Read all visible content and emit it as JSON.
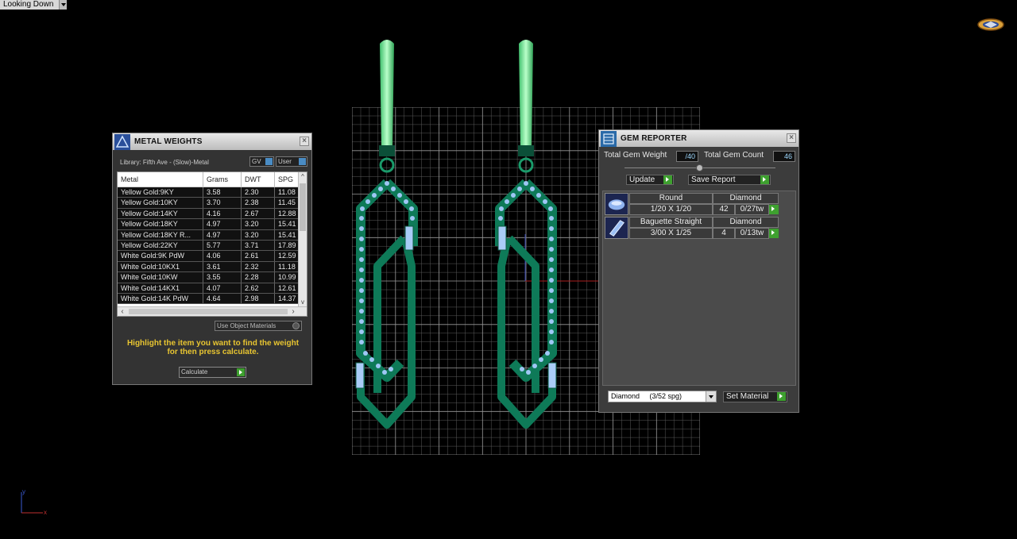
{
  "view": {
    "label": "Looking Down"
  },
  "metal_weights": {
    "title": "METAL WEIGHTS",
    "library": "Library: Fifth Ave - (Slow)-Metal",
    "gv": "GV",
    "user": "User",
    "columns": [
      "Metal",
      "Grams",
      "DWT",
      "SPG"
    ],
    "rows": [
      [
        "Yellow Gold:9KY",
        "3.58",
        "2.30",
        "11.08"
      ],
      [
        "Yellow Gold:10KY",
        "3.70",
        "2.38",
        "11.45"
      ],
      [
        "Yellow Gold:14KY",
        "4.16",
        "2.67",
        "12.88"
      ],
      [
        "Yellow Gold:18KY",
        "4.97",
        "3.20",
        "15.41"
      ],
      [
        "Yellow Gold:18KY R...",
        "4.97",
        "3.20",
        "15.41"
      ],
      [
        "Yellow Gold:22KY",
        "5.77",
        "3.71",
        "17.89"
      ],
      [
        "White Gold:9K PdW",
        "4.06",
        "2.61",
        "12.59"
      ],
      [
        "White Gold:10KX1",
        "3.61",
        "2.32",
        "11.18"
      ],
      [
        "White Gold:10KW",
        "3.55",
        "2.28",
        "10.99"
      ],
      [
        "White Gold:14KX1",
        "4.07",
        "2.62",
        "12.61"
      ],
      [
        "White Gold:14K PdW",
        "4.64",
        "2.98",
        "14.37"
      ]
    ],
    "use_object_materials": "Use Object Materials",
    "hint_line1": "Highlight the item you want to find the weight",
    "hint_line2": "for then press calculate.",
    "calculate": "Calculate"
  },
  "gem_reporter": {
    "title": "GEM REPORTER",
    "total_weight_label": "Total Gem Weight",
    "total_weight_value": "/40",
    "total_count_label": "Total Gem Count",
    "total_count_value": "46",
    "update": "Update",
    "save_report": "Save Report",
    "gems": [
      {
        "shape": "Round",
        "material": "Diamond",
        "size": "1/20 X 1/20",
        "count": "42",
        "weight": "0/27tw"
      },
      {
        "shape": "Baguette Straight",
        "material": "Diamond",
        "size": "3/00 X 1/25",
        "count": "4",
        "weight": "0/13tw"
      }
    ],
    "material_select": "Diamond     (3/52 spg)",
    "set_material": "Set Material"
  },
  "colors": {
    "metal_green": "#0e7a58",
    "hook_green": "#79e39a",
    "stone_blue": "#8fb9f2",
    "grid": "#6a6a6a"
  }
}
